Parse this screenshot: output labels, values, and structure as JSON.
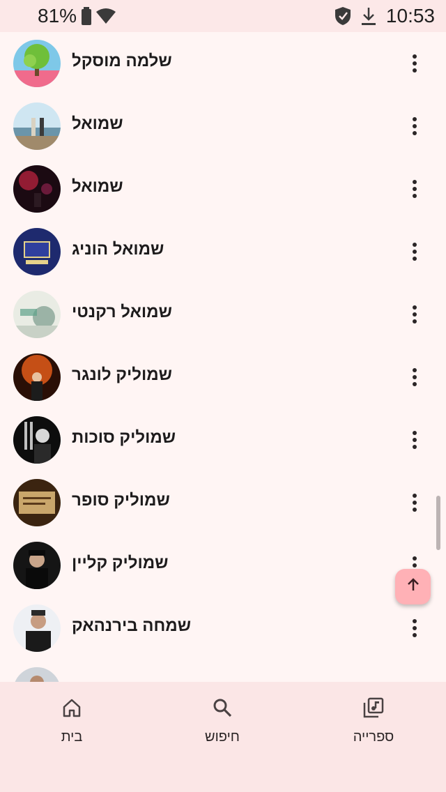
{
  "status_bar": {
    "battery_percent": "81%",
    "time": "10:53",
    "icons": [
      "battery-icon",
      "wifi-icon",
      "shield-icon",
      "download-icon"
    ]
  },
  "artists": [
    {
      "name": "שלמה מוסקל"
    },
    {
      "name": "שמואל"
    },
    {
      "name": "שמואל"
    },
    {
      "name": "שמואל הוניג"
    },
    {
      "name": "שמואל רקנטי"
    },
    {
      "name": "שמוליק לונגר"
    },
    {
      "name": "שמוליק סוכות"
    },
    {
      "name": "שמוליק סופר"
    },
    {
      "name": "שמוליק קליין"
    },
    {
      "name": "שמחה בירנהאק"
    }
  ],
  "fab": {
    "icon": "arrow-up-icon"
  },
  "bottom_nav": {
    "items": [
      {
        "label": "בית",
        "icon": "home-icon"
      },
      {
        "label": "חיפוש",
        "icon": "search-icon"
      },
      {
        "label": "ספרייה",
        "icon": "library-music-icon"
      }
    ]
  },
  "colors": {
    "background": "#fff5f4",
    "nav_background": "#fbe6e6",
    "fab": "#ffb1b6"
  }
}
